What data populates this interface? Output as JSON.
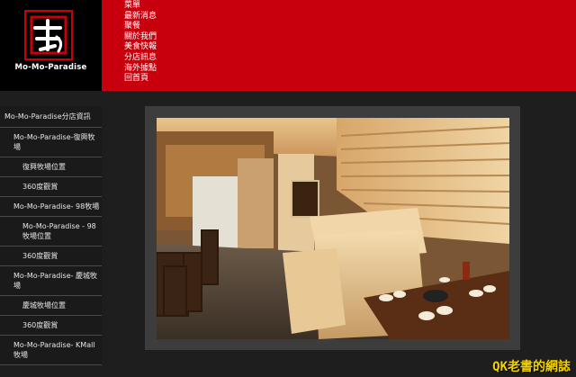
{
  "header": {
    "logo": {
      "mark_text": "モラハ",
      "brand_text": "Mo-Mo-Paradise"
    },
    "nav": [
      {
        "label": "菜單"
      },
      {
        "label": "最新消息"
      },
      {
        "label": "聚餐"
      },
      {
        "label": "關於我們"
      },
      {
        "label": "美食快報"
      },
      {
        "label": "分店訊息"
      },
      {
        "label": "海外據點"
      },
      {
        "label": "回首頁"
      }
    ],
    "bg_color": "#c8000d"
  },
  "sidebar": {
    "items": [
      {
        "label": "Mo-Mo-Paradise分店資訊",
        "level": 0
      },
      {
        "label": "Mo-Mo-Paradise-復興牧場",
        "level": 1
      },
      {
        "label": "復興牧場位置",
        "level": 2
      },
      {
        "label": "360度觀賞",
        "level": 2
      },
      {
        "label": "Mo-Mo-Paradise- 98牧場",
        "level": 1
      },
      {
        "label": "Mo-Mo-Paradise - 98牧場位置",
        "level": 2
      },
      {
        "label": "360度觀賞",
        "level": 2
      },
      {
        "label": "Mo-Mo-Paradise- 慶城牧場",
        "level": 1
      },
      {
        "label": "慶城牧場位置",
        "level": 2
      },
      {
        "label": "360度觀賞",
        "level": 2
      },
      {
        "label": "Mo-Mo-Paradise- KMall牧場",
        "level": 1
      }
    ]
  },
  "content": {
    "photo_icon": "restaurant-interior-photo"
  },
  "watermark": {
    "text": "QK老書的網誌",
    "color": "#f2d200"
  }
}
